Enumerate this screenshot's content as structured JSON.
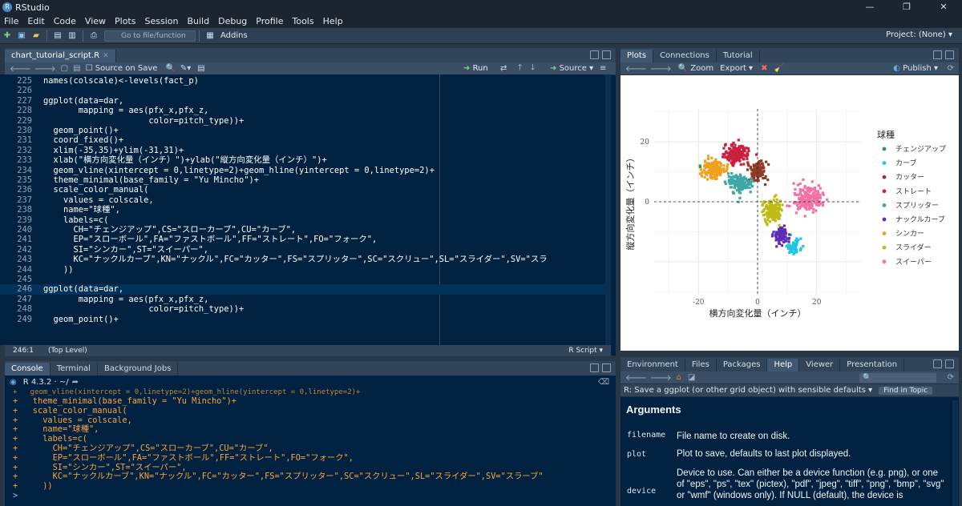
{
  "window": {
    "title": "RStudio"
  },
  "menu": [
    "File",
    "Edit",
    "Code",
    "View",
    "Plots",
    "Session",
    "Build",
    "Debug",
    "Profile",
    "Tools",
    "Help"
  ],
  "toolbar": {
    "goto_placeholder": "Go to file/function",
    "addins": "Addins",
    "project": "Project: (None)"
  },
  "editor": {
    "tab": "chart_tutorial_script.R",
    "source_on_save": "Source on Save",
    "run": "Run",
    "source": "Source",
    "lines": [
      {
        "n": "225",
        "code": "names(colscale)<-levels(fact_p)"
      },
      {
        "n": "226",
        "code": ""
      },
      {
        "n": "227",
        "code": "ggplot(data=dar,"
      },
      {
        "n": "228",
        "code": "       mapping = aes(pfx_x,pfx_z,"
      },
      {
        "n": "229",
        "code": "                     color=pitch_type))+"
      },
      {
        "n": "230",
        "code": "  geom_point()+"
      },
      {
        "n": "231",
        "code": "  coord_fixed()+"
      },
      {
        "n": "232",
        "code": "  xlim(-35,35)+ylim(-31,31)+"
      },
      {
        "n": "233",
        "code": "  xlab(\"横方向変化量（インチ）\")+ylab(\"縦方向変化量（インチ）\")+"
      },
      {
        "n": "234",
        "code": "  geom_vline(xintercept = 0,linetype=2)+geom_hline(yintercept = 0,linetype=2)+"
      },
      {
        "n": "235",
        "code": "  theme_minimal(base_family = \"Yu Mincho\")+"
      },
      {
        "n": "236",
        "code": "  scale_color_manual("
      },
      {
        "n": "237",
        "code": "    values = colscale,"
      },
      {
        "n": "238",
        "code": "    name=\"球種\","
      },
      {
        "n": "239",
        "code": "    labels=c("
      },
      {
        "n": "240",
        "code": "      CH=\"チェンジアップ\",CS=\"スローカーブ\",CU=\"カーブ\","
      },
      {
        "n": "241",
        "code": "      EP=\"スローボール\",FA=\"ファストボール\",FF=\"ストレート\",FO=\"フォーク\","
      },
      {
        "n": "242",
        "code": "      SI=\"シンカー\",ST=\"スイーパー\","
      },
      {
        "n": "243",
        "code": "      KC=\"ナックルカーブ\",KN=\"ナックル\",FC=\"カッター\",FS=\"スプリッター\",SC=\"スクリュー\",SL=\"スライダー\",SV=\"スラ"
      },
      {
        "n": "244",
        "code": "    ))"
      },
      {
        "n": "245",
        "code": ""
      },
      {
        "n": "246",
        "code": "ggplot(data=dar,"
      },
      {
        "n": "247",
        "code": "       mapping = aes(pfx_x,pfx_z,"
      },
      {
        "n": "248",
        "code": "                     color=pitch_type))+"
      },
      {
        "n": "249",
        "code": "  geom_point()+"
      }
    ],
    "status_pos": "246:1",
    "status_level": "(Top Level)",
    "status_type": "R Script"
  },
  "console": {
    "tabs": [
      "Console",
      "Terminal",
      "Background Jobs"
    ],
    "version": "R 4.3.2 · ~/",
    "lines": [
      "+   theme_minimal(base_family = \"Yu Mincho\")+",
      "+   scale_color_manual(",
      "+     values = colscale,",
      "+     name=\"球種\",",
      "+     labels=c(",
      "+       CH=\"チェンジアップ\",CS=\"スローカーブ\",CU=\"カーブ\",",
      "+       EP=\"スローボール\",FA=\"ファストボール\",FF=\"ストレート\",FO=\"フォーク\",",
      "+       SI=\"シンカー\",ST=\"スイーパー\",",
      "+       KC=\"ナックルカーブ\",KN=\"ナックル\",FC=\"カッター\",FS=\"スプリッター\",SC=\"スクリュー\",SL=\"スライダー\",SV=\"スラーブ\"",
      "+     ))",
      ">"
    ]
  },
  "plots_pane": {
    "tabs": [
      "Plots",
      "Connections",
      "Tutorial"
    ],
    "zoom": "Zoom",
    "export": "Export",
    "publish": "Publish"
  },
  "chart_data": {
    "type": "scatter",
    "xlabel": "横方向変化量（インチ）",
    "ylabel": "縦方向変化量（インチ）",
    "xticks": [
      "-20",
      "0",
      "20"
    ],
    "yticks": [
      "20",
      "0"
    ],
    "xlim": [
      -35,
      35
    ],
    "ylim": [
      -31,
      31
    ],
    "legend_title": "球種",
    "legend_position": "right",
    "series": [
      {
        "name": "チェンジアップ",
        "color": "#2a9d48",
        "center": [
          -19,
          12
        ],
        "spread": [
          1,
          1
        ],
        "n": 3
      },
      {
        "name": "カーブ",
        "color": "#1ec6e6",
        "center": [
          12,
          -15
        ],
        "spread": [
          2.5,
          2
        ],
        "n": 60
      },
      {
        "name": "カッター",
        "color": "#8e3b24",
        "center": [
          0,
          10
        ],
        "spread": [
          2.5,
          3
        ],
        "n": 120
      },
      {
        "name": "ストレート",
        "color": "#c8203d",
        "center": [
          -7,
          16
        ],
        "spread": [
          3.5,
          2.5
        ],
        "n": 160
      },
      {
        "name": "スプリッター",
        "color": "#3da7a3",
        "center": [
          -6,
          6
        ],
        "spread": [
          3.5,
          2.5
        ],
        "n": 150
      },
      {
        "name": "ナックルカーブ",
        "color": "#5e2db3",
        "center": [
          8,
          -11
        ],
        "spread": [
          2,
          2.5
        ],
        "n": 90
      },
      {
        "name": "シンカー",
        "color": "#f0a01c",
        "center": [
          -15,
          11
        ],
        "spread": [
          3,
          2.5
        ],
        "n": 150
      },
      {
        "name": "スライダー",
        "color": "#bfbb16",
        "center": [
          5,
          -3
        ],
        "spread": [
          2.5,
          3
        ],
        "n": 150
      },
      {
        "name": "スイーパー",
        "color": "#f072a6",
        "center": [
          17,
          1
        ],
        "spread": [
          4,
          3.5
        ],
        "n": 200
      }
    ]
  },
  "help_pane": {
    "tabs": [
      "Environment",
      "Files",
      "Packages",
      "Help",
      "Viewer",
      "Presentation"
    ],
    "topic": "R: Save a ggplot (or other grid object) with sensible defaults",
    "find": "Find in Topic",
    "heading": "Arguments",
    "args": [
      {
        "name": "filename",
        "desc": "File name to create on disk."
      },
      {
        "name": "plot",
        "desc": "Plot to save, defaults to last plot displayed."
      },
      {
        "name": "device",
        "desc": "Device to use. Can either be a device function (e.g. png), or one of \"eps\", \"ps\", \"tex\" (pictex), \"pdf\", \"jpeg\", \"tiff\", \"png\", \"bmp\", \"svg\" or \"wmf\" (windows only). If NULL (default), the device is"
      }
    ]
  }
}
